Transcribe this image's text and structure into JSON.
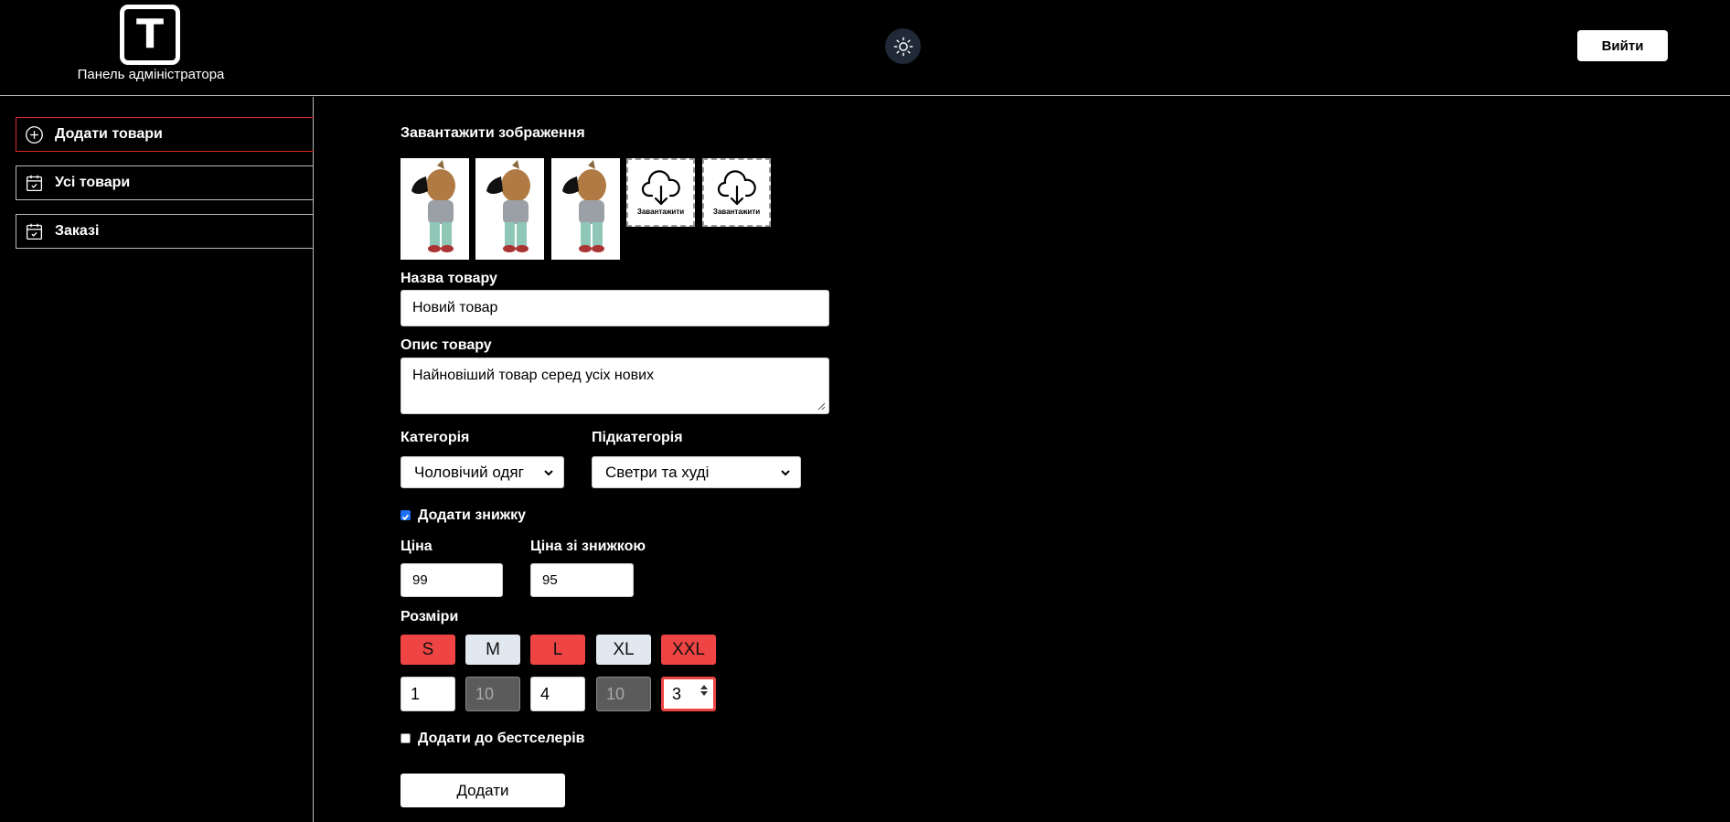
{
  "header": {
    "logo_letter": "T",
    "logo_caption": "Панель адміністратора",
    "logout_label": "Вийти"
  },
  "sidebar": {
    "items": [
      {
        "label": "Додати товари",
        "icon": "plus-circle-icon",
        "active": true
      },
      {
        "label": "Усі товари",
        "icon": "calendar-check-icon",
        "active": false
      },
      {
        "label": "Заказі",
        "icon": "calendar-check-icon",
        "active": false
      }
    ]
  },
  "form": {
    "upload_title": "Завантажити зображення",
    "upload_label": "Завантажити",
    "uploaded_images": 3,
    "name_label": "Назва товару",
    "name_value": "Новий товар",
    "desc_label": "Опис товару",
    "desc_value": "Найновіший товар серед усіх нових",
    "category_label": "Категорія",
    "category_value": "Чоловічий одяг",
    "subcategory_label": "Підкатегорія",
    "subcategory_value": "Светри та худі",
    "discount_label": "Додати знижку",
    "discount_checked": true,
    "price_label": "Ціна",
    "price_value": "99",
    "discount_price_label": "Ціна зі знижкою",
    "discount_price_value": "95",
    "sizes_label": "Розміри",
    "sizes": [
      {
        "name": "S",
        "selected": true,
        "qty": "1"
      },
      {
        "name": "M",
        "selected": false,
        "qty": "10"
      },
      {
        "name": "L",
        "selected": true,
        "qty": "4"
      },
      {
        "name": "XL",
        "selected": false,
        "qty": "10"
      },
      {
        "name": "XXL",
        "selected": true,
        "qty": "3"
      }
    ],
    "bestseller_label": "Додати до бестселерів",
    "bestseller_checked": false,
    "submit_label": "Додати"
  },
  "colors": {
    "background": "#000000",
    "accent_red": "#ef4444",
    "size_unselected": "#e2e8f0",
    "checkbox_blue": "#1d6ef5"
  }
}
